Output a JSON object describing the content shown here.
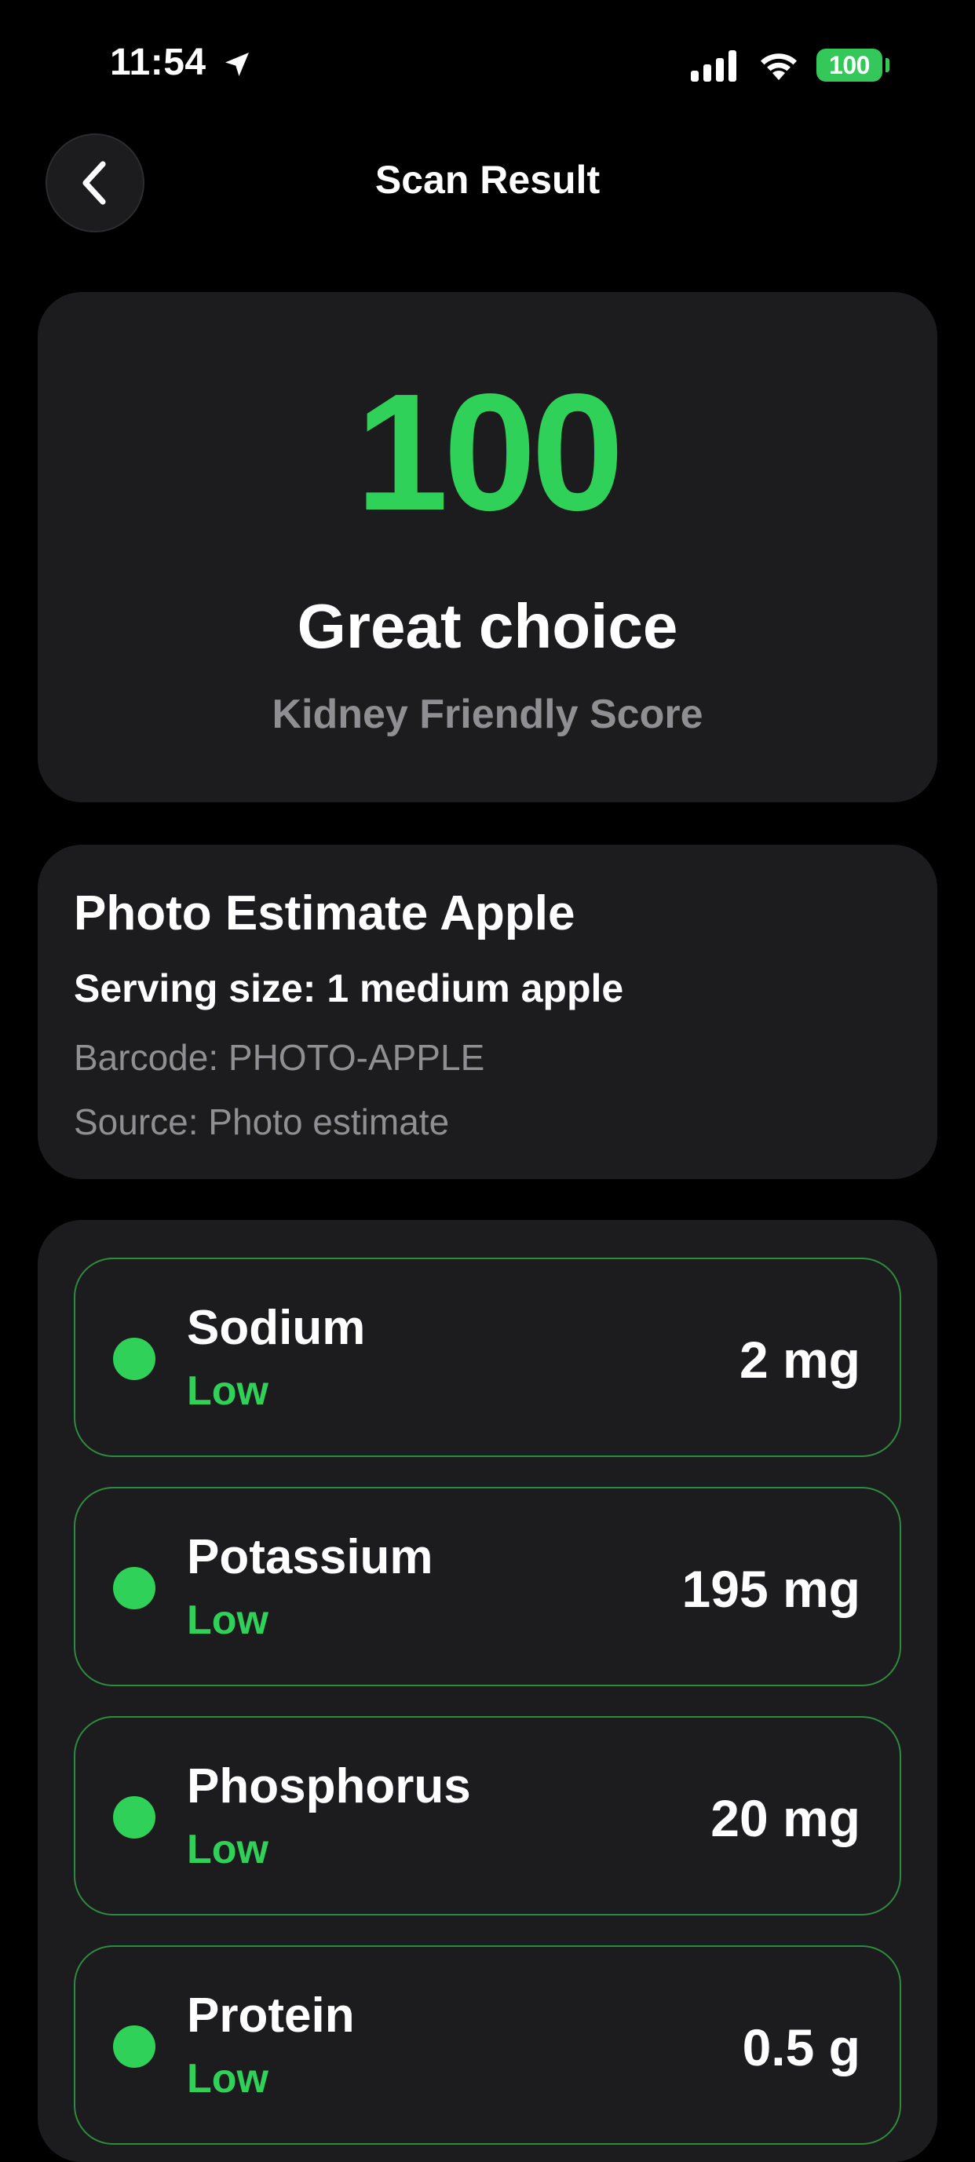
{
  "status_bar": {
    "time": "11:54",
    "battery": "100"
  },
  "nav": {
    "title": "Scan Result"
  },
  "score": {
    "value": "100",
    "verdict": "Great choice",
    "caption": "Kidney Friendly Score"
  },
  "product": {
    "name": "Photo Estimate Apple",
    "serving": "Serving size: 1 medium apple",
    "barcode": "Barcode: PHOTO-APPLE",
    "source": "Source: Photo estimate"
  },
  "nutrients": [
    {
      "name": "Sodium",
      "level": "Low",
      "amount": "2 mg"
    },
    {
      "name": "Potassium",
      "level": "Low",
      "amount": "195 mg"
    },
    {
      "name": "Phosphorus",
      "level": "Low",
      "amount": "20 mg"
    },
    {
      "name": "Protein",
      "level": "Low",
      "amount": "0.5 g"
    }
  ],
  "colors": {
    "background": "#000000",
    "card": "#1c1c1e",
    "accent_green": "#30d158",
    "row_border": "#2e8b3e",
    "secondary_text": "#8e8e93"
  },
  "icons": {
    "back": "chevron-left-icon",
    "location": "location-arrow-icon",
    "signal": "cellular-signal-icon",
    "wifi": "wifi-icon",
    "battery": "battery-icon"
  }
}
